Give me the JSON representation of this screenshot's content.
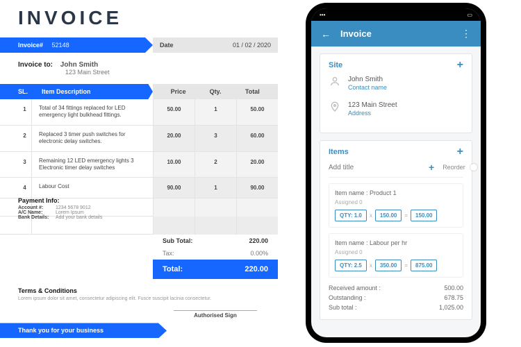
{
  "invoice": {
    "heading": "INVOICE",
    "label_invoice_no": "Invoice#",
    "invoice_no": "52148",
    "label_date": "Date",
    "date": "01 / 02 / 2020",
    "label_to": "Invoice to:",
    "to_name": "John Smith",
    "to_addr": "123 Main Street",
    "cols": {
      "sl": "SL.",
      "desc": "Item Description",
      "price": "Price",
      "qty": "Qty.",
      "total": "Total"
    },
    "rows": [
      {
        "sl": "1",
        "desc": "Total of 34 fittings replaced for LED emergency light bulkhead fittings.",
        "price": "50.00",
        "qty": "1",
        "total": "50.00"
      },
      {
        "sl": "2",
        "desc": "Replaced 3 timer push switches for electronic delay switches.",
        "price": "20.00",
        "qty": "3",
        "total": "60.00"
      },
      {
        "sl": "3",
        "desc": "Remaining 12 LED emergency lights\n3 Electronic timer delay switches",
        "price": "10.00",
        "qty": "2",
        "total": "20.00"
      },
      {
        "sl": "4",
        "desc": "Labour Cost",
        "price": "90.00",
        "qty": "1",
        "total": "90.00"
      }
    ],
    "subtotal_label": "Sub Total:",
    "subtotal": "220.00",
    "tax_label": "Tax:",
    "tax": "0.00%",
    "total_label": "Total:",
    "total": "220.00",
    "pay_heading": "Payment Info:",
    "pay_account_lbl": "Account #:",
    "pay_account": "1234 5678 9012",
    "pay_ac_lbl": "A/C Name:",
    "pay_ac": "Lorem Ipsum",
    "pay_bank_lbl": "Bank Details:",
    "pay_bank": "Add your bank details",
    "terms_heading": "Terms & Conditions",
    "terms_body": "Lorem ipsum dolor sit amet, consectetur adipiscing elit. Fusce suscipit lacinia consectetur.",
    "sign": "Authorised Sign",
    "thanks": "Thank you for your business"
  },
  "phone": {
    "status_time": "",
    "appbar_title": "Invoice",
    "site_label": "Site",
    "site_name": "John Smith",
    "site_name_sub": "Contact name",
    "site_addr": "123 Main Street",
    "site_addr_sub": "Address",
    "items_label": "Items",
    "add_title_placeholder": "Add title",
    "reorder": "Reorder",
    "items": [
      {
        "name_lbl": "Item name :",
        "name": "Product 1",
        "assigned_lbl": "Assigned",
        "assigned": "0",
        "qty_lbl": "QTY:",
        "qty": "1.0",
        "rate": "150.00",
        "amt": "150.00"
      },
      {
        "name_lbl": "Item name :",
        "name": "Labour per hr",
        "assigned_lbl": "Assigned",
        "assigned": "0",
        "qty_lbl": "QTY:",
        "qty": "2.5",
        "rate": "350.00",
        "amt": "875.00"
      }
    ],
    "received_lbl": "Received amount :",
    "received": "500.00",
    "outstanding_lbl": "Outstanding :",
    "outstanding": "678.75",
    "subtotal_lbl": "Sub total :",
    "subtotal": "1,025.00"
  }
}
